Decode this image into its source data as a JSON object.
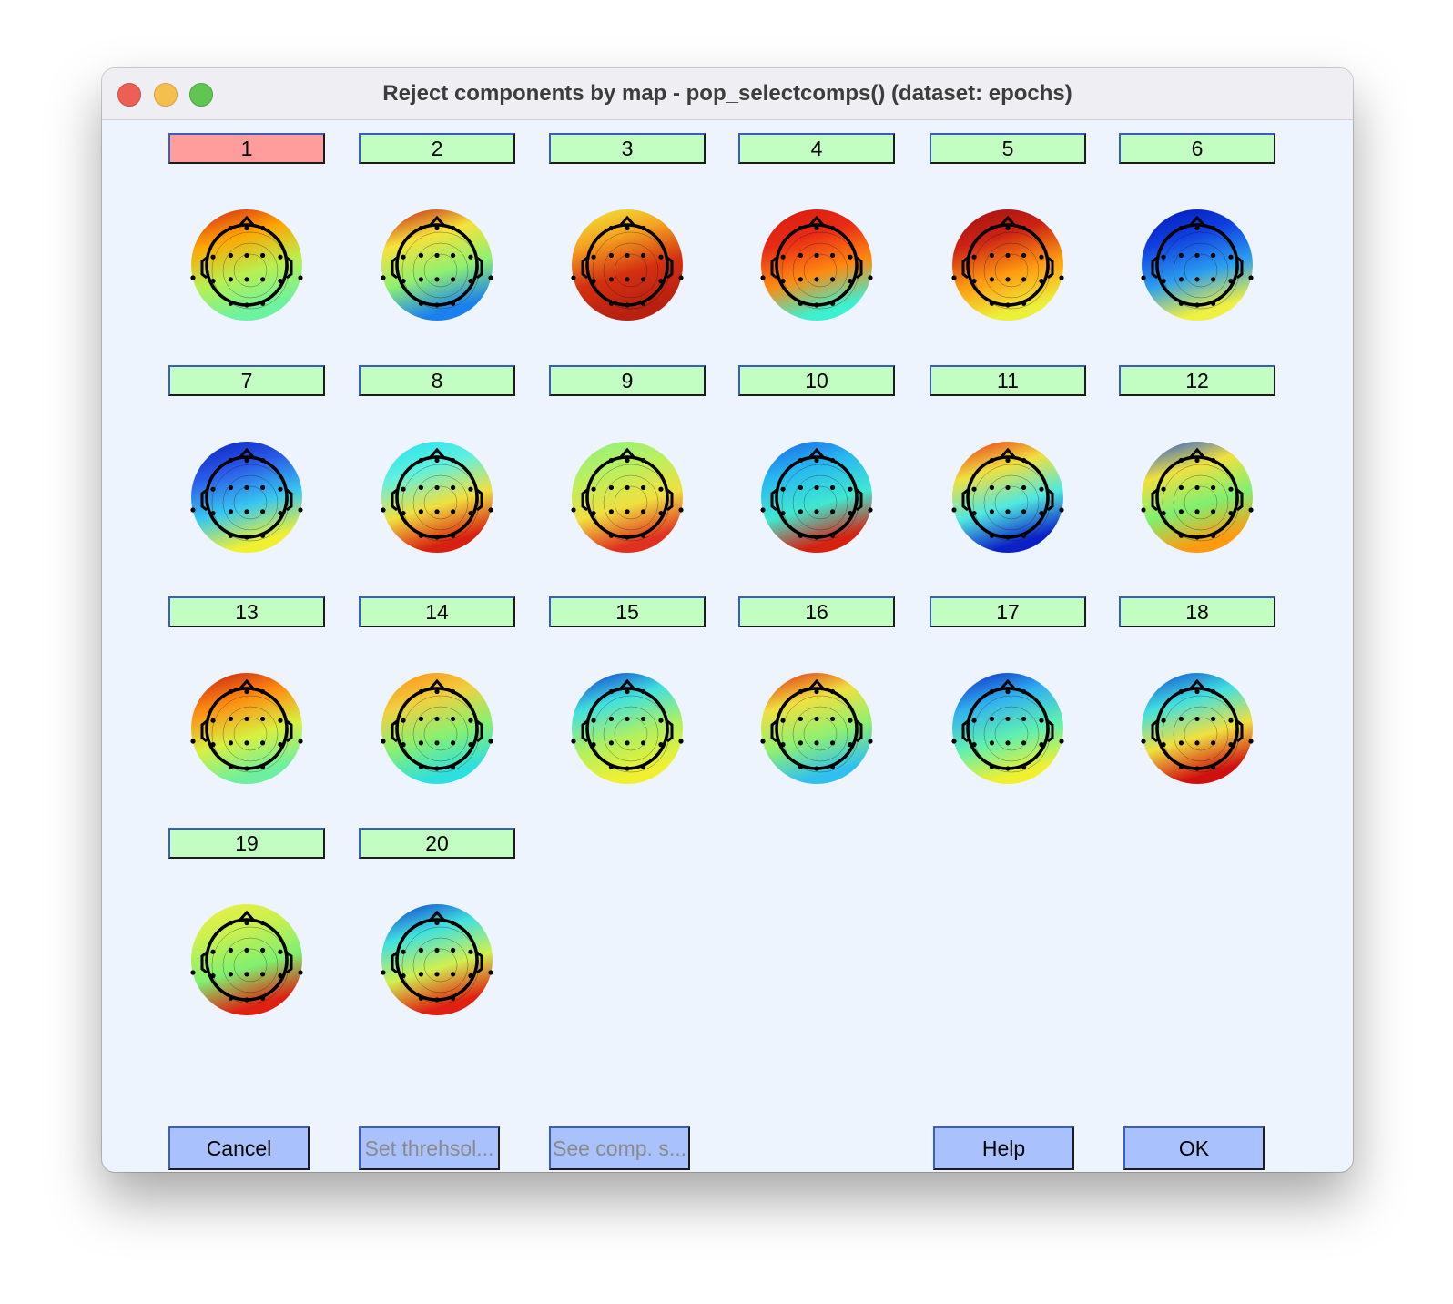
{
  "window": {
    "title": "Reject components by map - pop_selectcomps() (dataset: epochs)"
  },
  "components": [
    {
      "label": "1",
      "rejected": true,
      "colors": [
        "#d21a1a",
        "#ffa500",
        "#b8f050",
        "#6cf2a0"
      ]
    },
    {
      "label": "2",
      "rejected": false,
      "colors": [
        "#c01515",
        "#f6e23a",
        "#90f070",
        "#1a80f0"
      ]
    },
    {
      "label": "3",
      "rejected": false,
      "colors": [
        "#f2ec3a",
        "#f4a220",
        "#d43010",
        "#b82010"
      ]
    },
    {
      "label": "4",
      "rejected": false,
      "colors": [
        "#d81a10",
        "#e82a15",
        "#ff8a10",
        "#3cf0d0"
      ]
    },
    {
      "label": "5",
      "rejected": false,
      "colors": [
        "#a01010",
        "#cc2214",
        "#ff9a10",
        "#ecf03a"
      ]
    },
    {
      "label": "6",
      "rejected": false,
      "colors": [
        "#0015b8",
        "#1040e0",
        "#2a9ef0",
        "#f0f040"
      ]
    },
    {
      "label": "7",
      "rejected": false,
      "colors": [
        "#0a1cc0",
        "#2a5ae8",
        "#38c8f0",
        "#f0f030"
      ]
    },
    {
      "label": "8",
      "rejected": false,
      "colors": [
        "#1ee0f0",
        "#60f0e0",
        "#f0e040",
        "#d82010"
      ]
    },
    {
      "label": "9",
      "rejected": false,
      "colors": [
        "#8ef080",
        "#b8f060",
        "#f0e040",
        "#e03020"
      ]
    },
    {
      "label": "10",
      "rejected": false,
      "colors": [
        "#1860e8",
        "#28b8f0",
        "#40e8d0",
        "#d82010"
      ]
    },
    {
      "label": "11",
      "rejected": false,
      "colors": [
        "#e82a15",
        "#f0e040",
        "#50e8e0",
        "#0c20c8"
      ]
    },
    {
      "label": "12",
      "rejected": false,
      "colors": [
        "#1850e0",
        "#f0e040",
        "#80f070",
        "#ff9a10"
      ]
    },
    {
      "label": "13",
      "rejected": false,
      "colors": [
        "#c01515",
        "#ff8a10",
        "#d8f040",
        "#6cf0a0"
      ]
    },
    {
      "label": "14",
      "rejected": false,
      "colors": [
        "#ff8a10",
        "#f0d040",
        "#88f070",
        "#2ce0e0"
      ]
    },
    {
      "label": "15",
      "rejected": false,
      "colors": [
        "#0c30d0",
        "#40e0e0",
        "#b0f060",
        "#f0f030"
      ]
    },
    {
      "label": "16",
      "rejected": false,
      "colors": [
        "#e02010",
        "#f0e040",
        "#90f070",
        "#30c0f0"
      ]
    },
    {
      "label": "17",
      "rejected": false,
      "colors": [
        "#0c20c0",
        "#30b0f0",
        "#60f0b0",
        "#f0f030"
      ]
    },
    {
      "label": "18",
      "rejected": false,
      "colors": [
        "#1040d0",
        "#40e0e0",
        "#f0e040",
        "#d01010"
      ]
    },
    {
      "label": "19",
      "rejected": false,
      "colors": [
        "#f0f040",
        "#c8f050",
        "#80f070",
        "#e02010"
      ]
    },
    {
      "label": "20",
      "rejected": false,
      "colors": [
        "#0c30d0",
        "#40e0e0",
        "#d0f050",
        "#e02010"
      ]
    }
  ],
  "buttons": {
    "cancel": "Cancel",
    "set_threshold": "Set threhsol...",
    "see_comp_stats": "See comp. s...",
    "help": "Help",
    "ok": "OK"
  }
}
